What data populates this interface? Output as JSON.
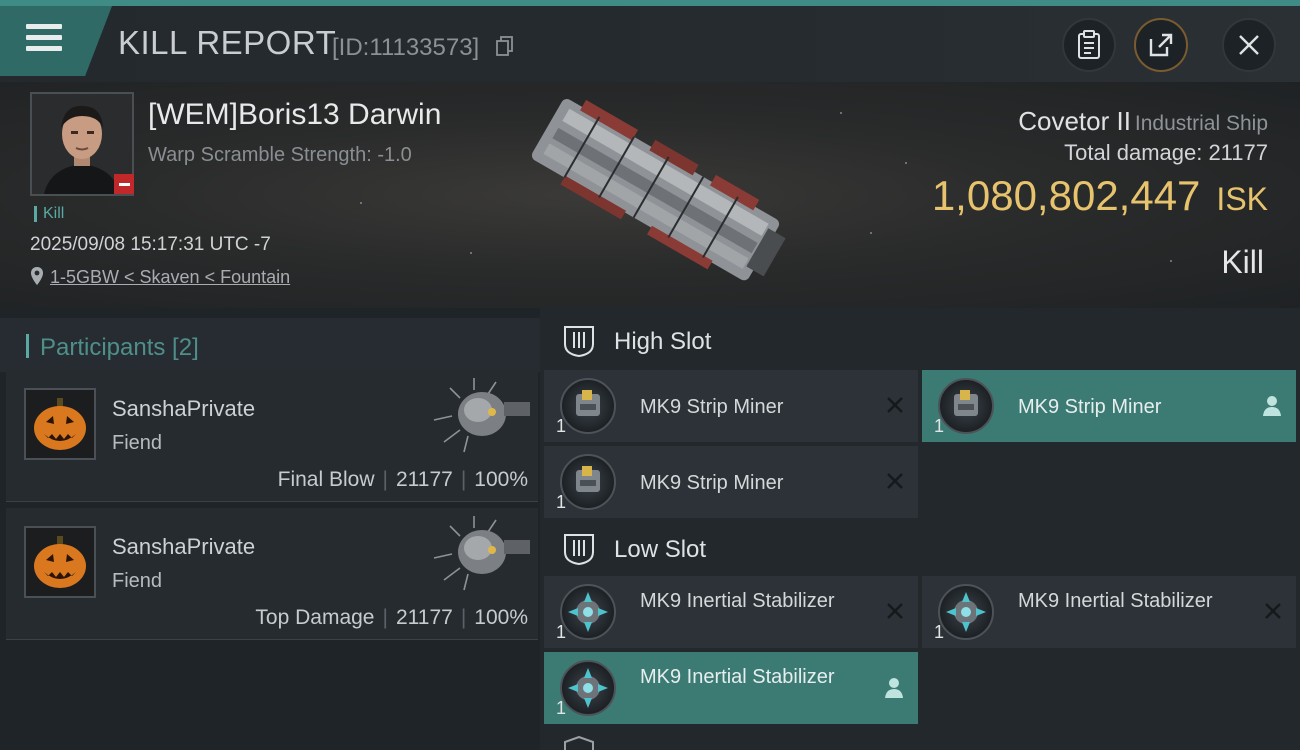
{
  "header": {
    "title": "KILL REPORT",
    "report_id": "[ID:11133573]"
  },
  "victim": {
    "pilot": "[WEM]Boris13 Darwin",
    "warp_scramble": "Warp Scramble Strength: -1.0",
    "tag": "Kill",
    "datetime": "2025/09/08 15:17:31 UTC -7",
    "location": "1-5GBW < Skaven < Fountain",
    "ship_name": "Covetor II",
    "ship_type": "Industrial Ship",
    "total_damage": "Total damage:  21177",
    "isk_value": "1,080,802,447",
    "isk_currency": "ISK",
    "outcome": "Kill"
  },
  "participants": {
    "label": "Participants [2]",
    "items": [
      {
        "name": "SanshaPrivate",
        "corp": "Fiend",
        "role": "Final Blow",
        "damage": "21177",
        "percent": "100%"
      },
      {
        "name": "SanshaPrivate",
        "corp": "Fiend",
        "role": "Top Damage",
        "damage": "21177",
        "percent": "100%"
      }
    ]
  },
  "fitting": {
    "high_slot_label": "High Slot",
    "low_slot_label": "Low Slot",
    "high": [
      {
        "qty": "1",
        "name": "MK9 Strip Miner",
        "status": "destroyed"
      },
      {
        "qty": "1",
        "name": "MK9 Strip Miner",
        "status": "dropped"
      },
      {
        "qty": "1",
        "name": "MK9 Strip Miner",
        "status": "destroyed"
      }
    ],
    "low": [
      {
        "qty": "1",
        "name": "MK9 Inertial Stabilizer",
        "status": "destroyed"
      },
      {
        "qty": "1",
        "name": "MK9 Inertial Stabilizer",
        "status": "destroyed"
      },
      {
        "qty": "1",
        "name": "MK9 Inertial Stabilizer",
        "status": "dropped"
      }
    ]
  },
  "colors": {
    "accent": "#3c7a74",
    "isk": "#e7c36e",
    "minus_badge": "#c0282a"
  },
  "icons": {
    "menu": "menu-icon",
    "copy": "copy-icon",
    "clipboard": "clipboard-icon",
    "share": "share-icon",
    "close": "close-icon",
    "location": "location-pin-icon",
    "destroyed": "close-x-icon",
    "dropped": "person-icon"
  }
}
